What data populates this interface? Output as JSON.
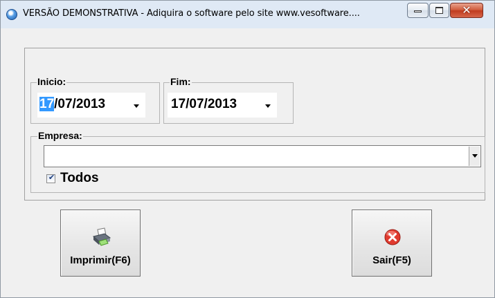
{
  "window": {
    "title": "VERSÃO DEMONSTRATIVA - Adiquira o software pelo site www.vesoftware...."
  },
  "filters": {
    "inicio": {
      "label": "Inicio:",
      "value_selected_part": "17",
      "value_rest": "/07/2013"
    },
    "fim": {
      "label": "Fim:",
      "value": "17/07/2013"
    },
    "empresa": {
      "label": "Empresa:",
      "value": ""
    },
    "todos": {
      "label": "Todos",
      "checked": true
    }
  },
  "actions": {
    "print_label": "Imprimir(F6)",
    "exit_label": "Sair(F5)"
  },
  "icons": {
    "app": "app-globe-icon",
    "print": "printer-icon",
    "exit": "close-circle-icon"
  },
  "colors": {
    "selection": "#3399ff",
    "exit_icon": "#e03b2f",
    "window_bg": "#f0f0f0"
  }
}
